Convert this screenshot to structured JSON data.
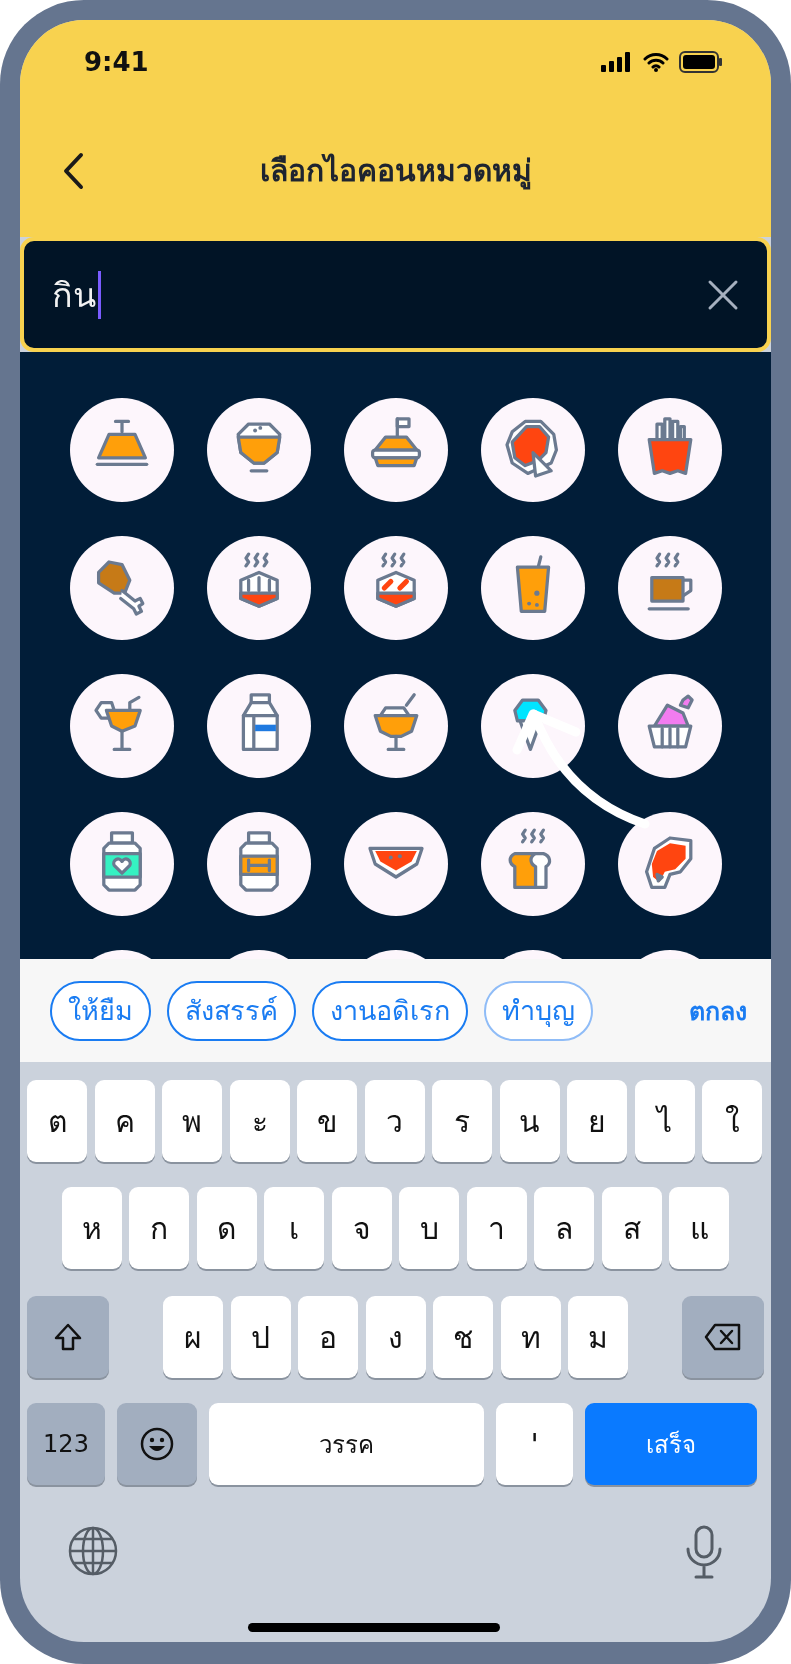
{
  "status_bar": {
    "time": "9:41"
  },
  "header": {
    "title": "เลือกไอคอนหมวดหมู่"
  },
  "search": {
    "value": "กิน"
  },
  "suggestions": [
    {
      "label": "ให้ยืม"
    },
    {
      "label": "สังสรรค์"
    },
    {
      "label": "งานอดิเรก"
    },
    {
      "label": "ทำบุญ"
    }
  ],
  "suggestion_action": "ตกลง",
  "keyboard": {
    "rows": [
      [
        "ต",
        "ค",
        "พ",
        "ะ",
        "ข",
        "ว",
        "ร",
        "น",
        "ย",
        "ไ",
        "ใ"
      ],
      [
        "ห",
        "ก",
        "ด",
        "เ",
        "จ",
        "บ",
        "า",
        "ล",
        "ส",
        "แ"
      ],
      [
        "ผ",
        "ป",
        "อ",
        "ง",
        "ช",
        "ท",
        "ม"
      ]
    ],
    "number_key": "123",
    "space": "วรรค",
    "apostrophe": "'",
    "return": "เสร็จ"
  }
}
